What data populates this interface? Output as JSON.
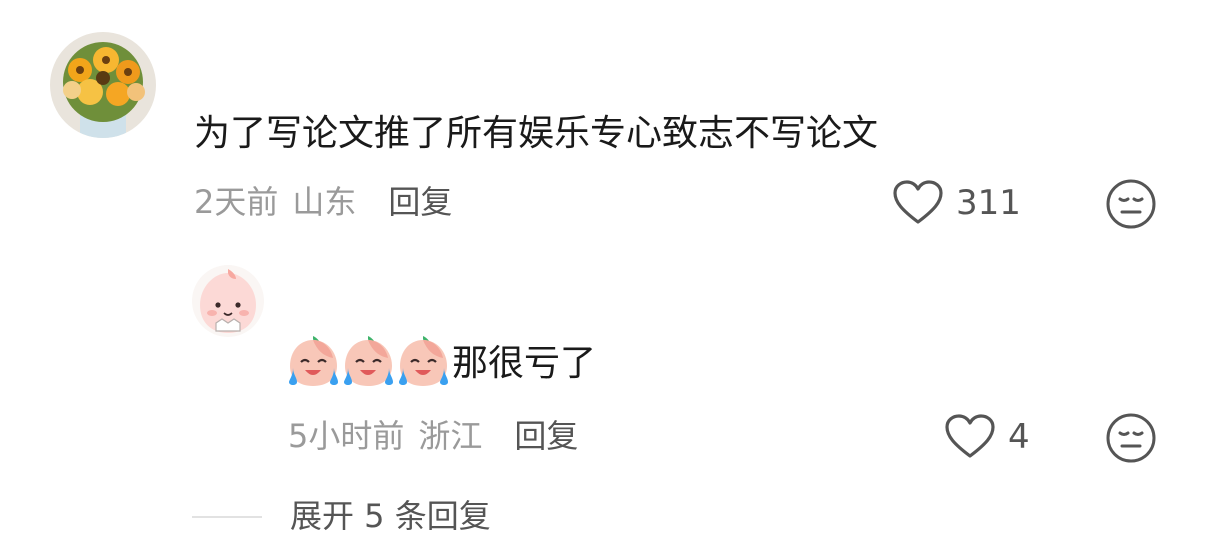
{
  "comment": {
    "text": "为了写论文推了所有娱乐专心致志不写论文",
    "time": "2天前",
    "location": "山东",
    "reply_label": "回复",
    "likes": "311"
  },
  "reply": {
    "text": "那很亏了",
    "emoji_count": 3,
    "time": "5小时前",
    "location": "浙江",
    "reply_label": "回复",
    "likes": "4"
  },
  "expand_label": "展开 5 条回复",
  "icons": {
    "like": "heart-outline-icon",
    "react": "neutral-face-icon",
    "emoji": "crying-peach-emoji"
  },
  "colors": {
    "text_primary": "#1a1a1a",
    "text_secondary": "#9a9a9a",
    "action": "#555555"
  }
}
